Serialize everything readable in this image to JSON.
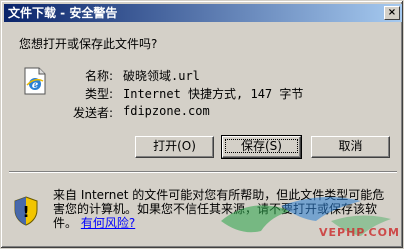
{
  "window": {
    "title": "文件下载 - 安全警告",
    "close_glyph": "×"
  },
  "question": "您想打开或保存此文件吗?",
  "file_icon": "internet-shortcut-icon",
  "info": [
    {
      "label": "名称:",
      "value": "破晓领域.url"
    },
    {
      "label": "类型:",
      "value": "Internet 快捷方式, 147 字节"
    },
    {
      "label": "发送者:",
      "value": "fdipzone.com"
    }
  ],
  "buttons": {
    "open": "打开(O)",
    "save": "保存(S)",
    "cancel": "取消"
  },
  "warning": {
    "icon": "security-shield-icon",
    "text": "来自 Internet 的文件可能对您有所帮助，但此文件类型可能危害您的计算机。如果您不信任其来源，请不要打开或保存该软件。",
    "link": "有何风险?"
  },
  "watermark": {
    "text": "VEPHP.COM"
  }
}
